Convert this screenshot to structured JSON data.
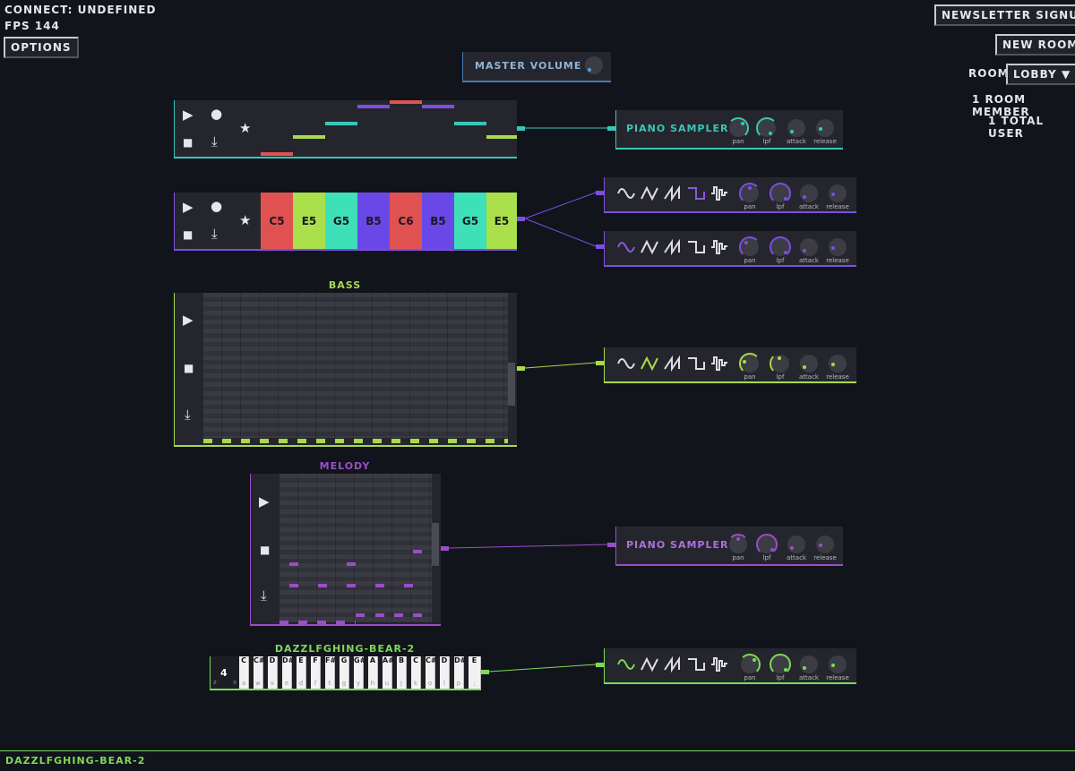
{
  "hud": {
    "connect": "CONNECT: UNDEFINED",
    "fps": "FPS 144",
    "options": "OPTIONS"
  },
  "top_right": {
    "newsletter": "NEWSLETTER SIGNUP",
    "new_room": "NEW ROOM",
    "room_label": "ROOM",
    "room_value": "LOBBY",
    "room_chevron": "▼",
    "members": "1 ROOM MEMBER",
    "users": "1 TOTAL USER"
  },
  "master": {
    "label": "MASTER VOLUME"
  },
  "transport_glyphs": {
    "play": "▶",
    "record": "●",
    "stop": "■",
    "download": "⤓",
    "star": "★"
  },
  "colors": {
    "teal": "#39c6b8",
    "purple": "#7e4ee0",
    "lime": "#a9d94c",
    "red": "#e05252",
    "green": "#7ed957",
    "violet": "#9a4ec9"
  },
  "sampler1": {
    "label": "PIANO SAMPLER",
    "knobs": [
      "pan",
      "lpf",
      "attack",
      "release"
    ]
  },
  "sampler2": {
    "label": "PIANO SAMPLER",
    "knobs": [
      "pan",
      "lpf",
      "attack",
      "release"
    ]
  },
  "step_seq": {
    "notes": [
      "C5",
      "E5",
      "G5",
      "B5",
      "C6",
      "B5",
      "G5",
      "E5"
    ]
  },
  "synth_knobs": [
    "pan",
    "lpf",
    "attack",
    "release"
  ],
  "bass": {
    "title": "BASS"
  },
  "melody": {
    "title": "MELODY"
  },
  "keyboard": {
    "title": "DAZZLFGHING-BEAR-2",
    "octave": "4",
    "keys": [
      "C",
      "C#",
      "D",
      "D#",
      "E",
      "F",
      "F#",
      "G",
      "G#",
      "A",
      "A#",
      "B",
      "C",
      "C#",
      "D",
      "D#",
      "E"
    ],
    "bindings": [
      "a",
      "w",
      "s",
      "e",
      "d",
      "f",
      "t",
      "g",
      "y",
      "h",
      "u",
      "j",
      "k",
      "o",
      "l",
      "p",
      ";"
    ],
    "left_bindings": [
      "z",
      "x"
    ]
  },
  "footer": {
    "name": "DAZZLFGHING-BEAR-2"
  }
}
